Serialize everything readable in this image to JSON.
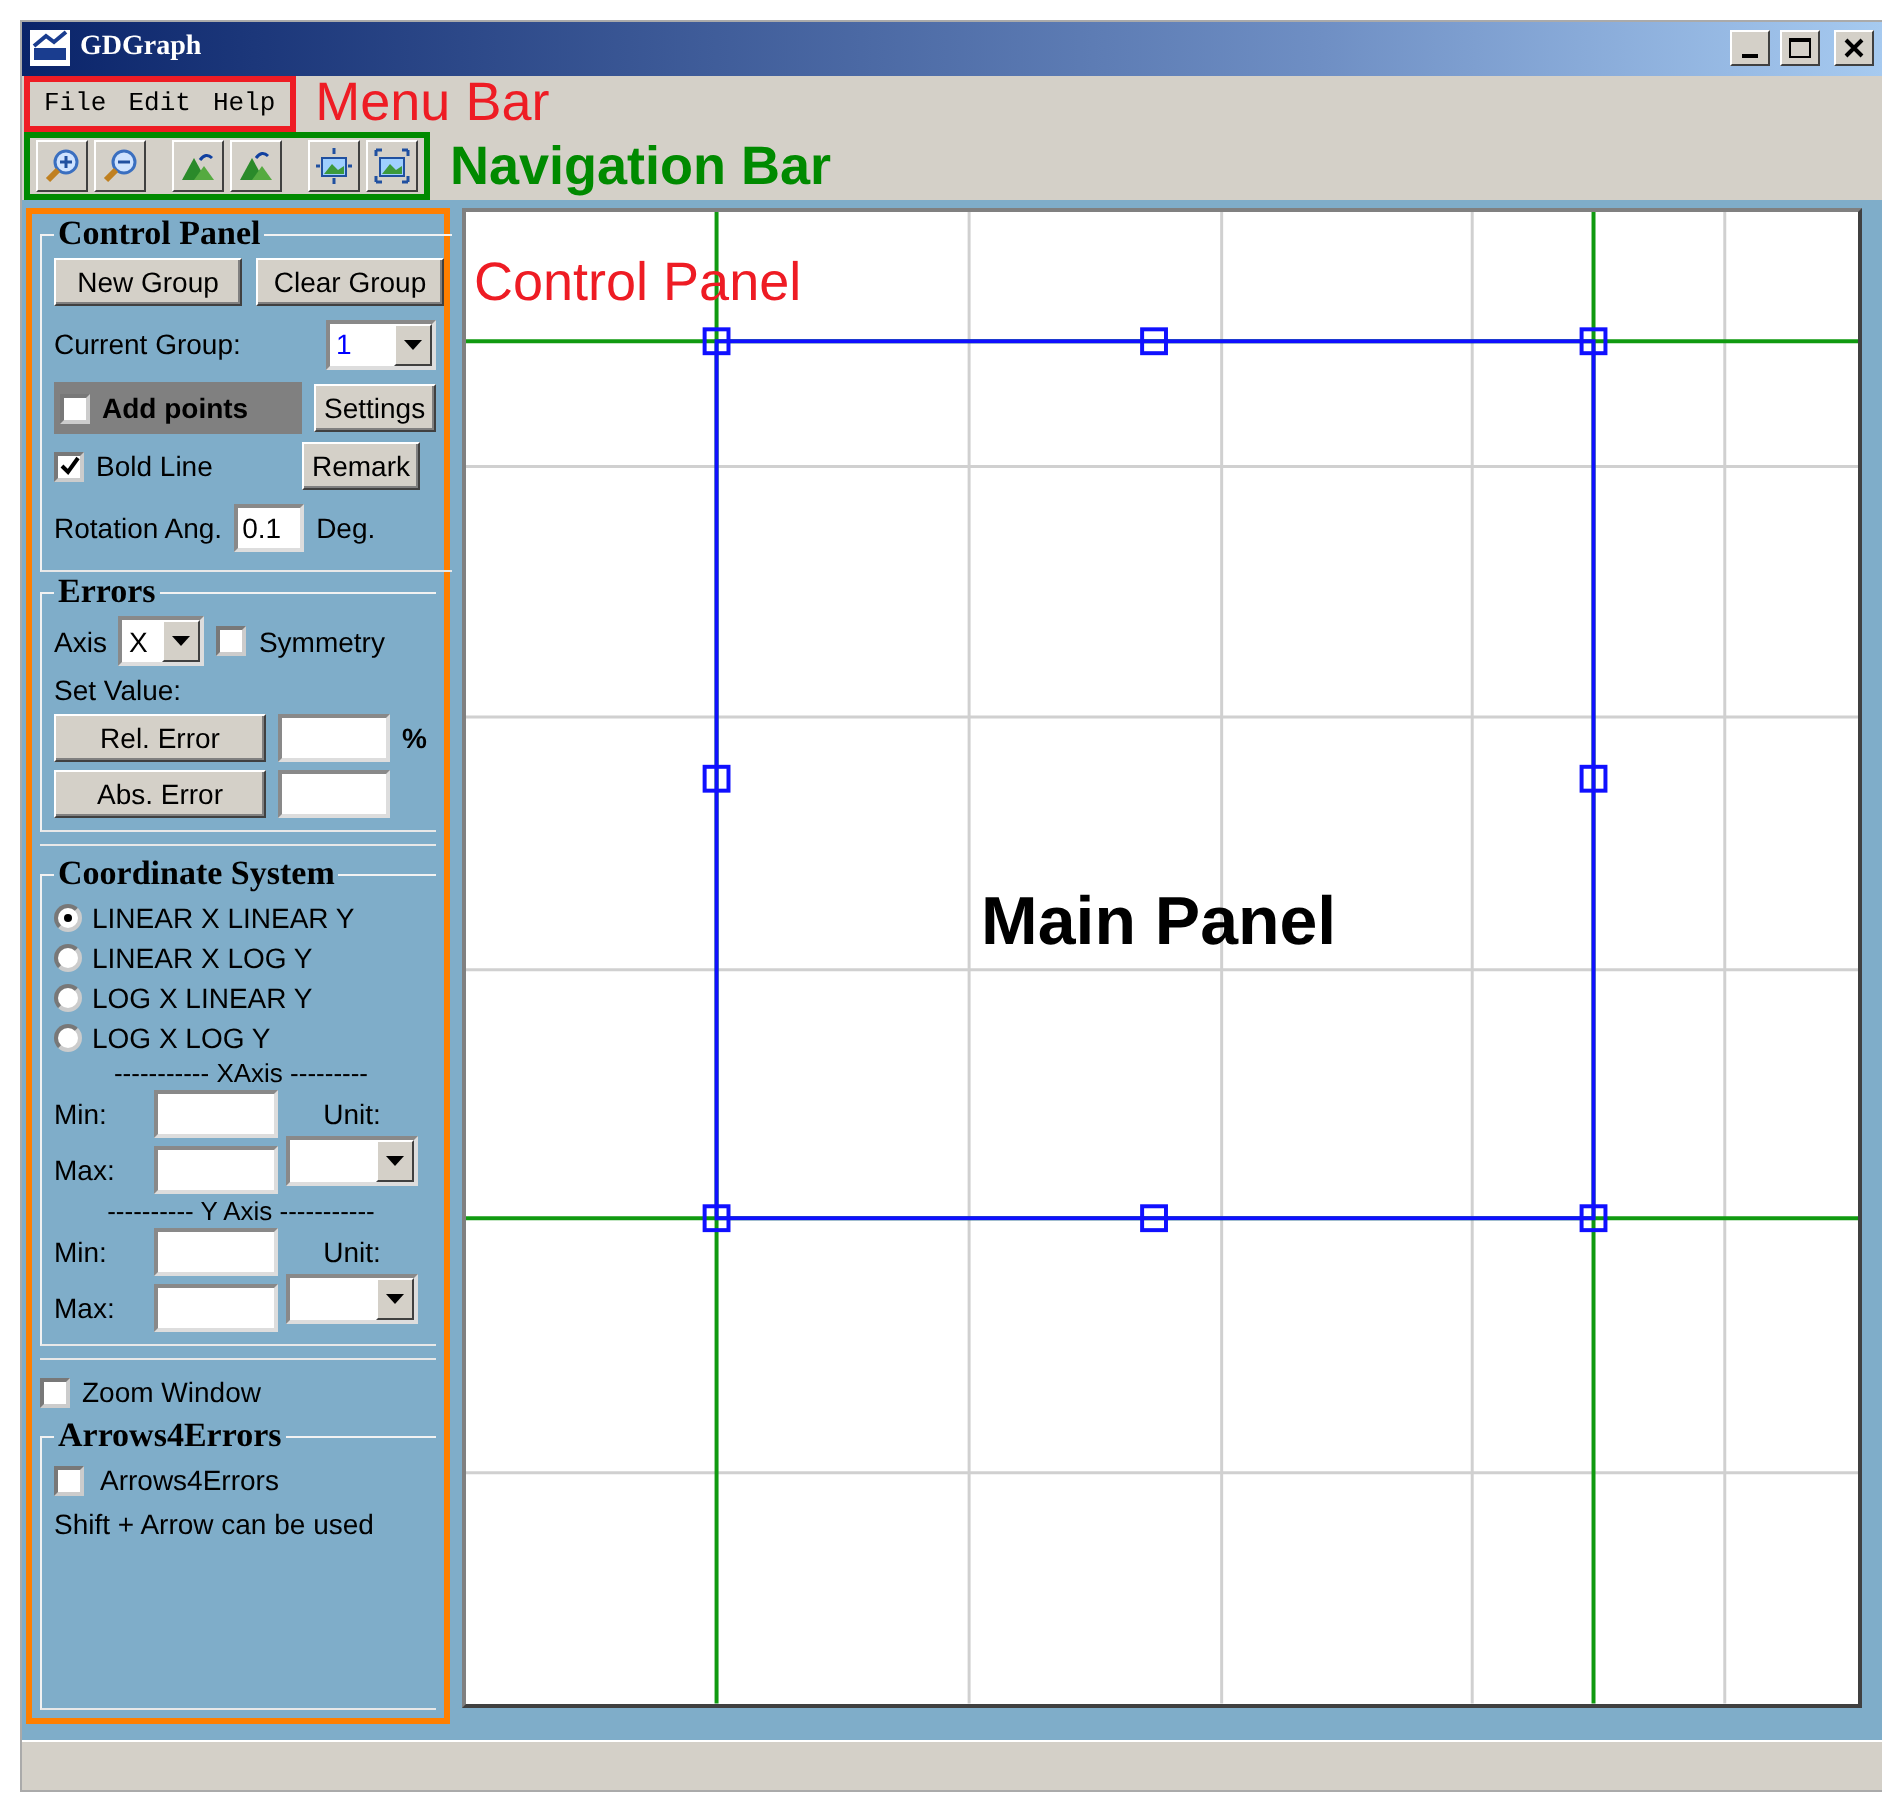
{
  "window": {
    "title": "GDGraph"
  },
  "menu_bar": {
    "items": [
      "File",
      "Edit",
      "Help"
    ],
    "annotation": "Menu Bar"
  },
  "navigation_bar": {
    "annotation": "Navigation Bar"
  },
  "control_panel": {
    "title": "Control Panel",
    "annotation": "Control Panel",
    "buttons": [
      "New Group",
      "Clear Group"
    ],
    "current_group": {
      "label": "Current Group:",
      "value": "1"
    },
    "add_points": {
      "label": "Add points",
      "checked": false
    },
    "settings_button": "Settings",
    "bold_line": {
      "label": "Bold Line",
      "checked": true
    },
    "remark_button": "Remark",
    "rotation": {
      "label": "Rotation Ang.",
      "value": "0.1",
      "unit": "Deg."
    }
  },
  "errors": {
    "title": "Errors",
    "axis": {
      "label": "Axis",
      "value": "X"
    },
    "symmetry": {
      "label": "Symmetry",
      "checked": false
    },
    "set_value_label": "Set Value:",
    "rel_error": {
      "button": "Rel. Error",
      "suffix": "%"
    },
    "abs_error": {
      "button": "Abs. Error"
    }
  },
  "coordinate_system": {
    "title": "Coordinate System",
    "options": [
      {
        "label": "LINEAR X LINEAR Y",
        "selected": true
      },
      {
        "label": "LINEAR X LOG Y",
        "selected": false
      },
      {
        "label": "LOG X LINEAR Y",
        "selected": false
      },
      {
        "label": "LOG X LOG Y",
        "selected": false
      }
    ],
    "axes": [
      {
        "heading": "----------- XAxis ---------",
        "min_label": "Min:",
        "max_label": "Max:",
        "unit_label": "Unit:"
      },
      {
        "heading": "---------- Y Axis -----------",
        "min_label": "Min:",
        "max_label": "Max:",
        "unit_label": "Unit:"
      }
    ]
  },
  "zoom_window": {
    "label": "Zoom Window",
    "checked": false
  },
  "arrows4errors": {
    "title": "Arrows4Errors",
    "checkbox": {
      "label": "Arrows4Errors",
      "checked": false
    },
    "note": "Shift + Arrow can be used"
  },
  "main_panel": {
    "annotation": "Main Panel"
  }
}
